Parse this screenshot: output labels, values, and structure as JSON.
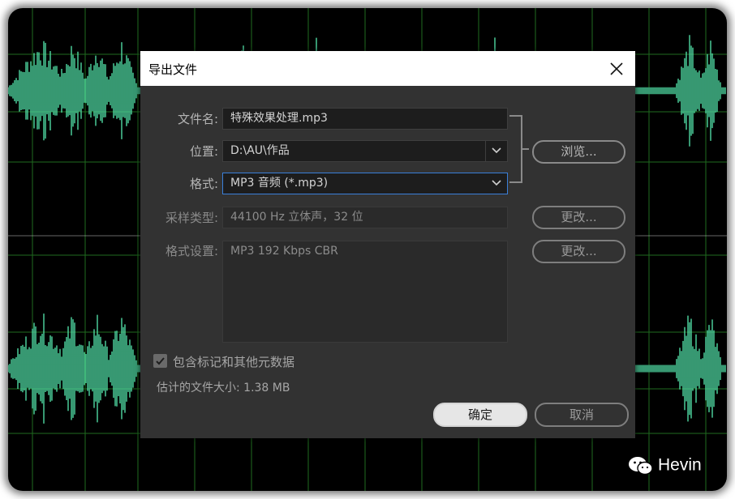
{
  "dialog": {
    "title": "导出文件",
    "filename_label": "文件名:",
    "filename_value": "特殊效果处理.mp3",
    "location_label": "位置:",
    "location_value": "D:\\AU\\作品",
    "format_label": "格式:",
    "format_value": "MP3 音频 (*.mp3)",
    "sample_type_label": "采样类型:",
    "sample_type_value": "44100 Hz 立体声，32 位",
    "format_settings_label": "格式设置:",
    "format_settings_value": "MP3 192 Kbps CBR",
    "browse_button": "浏览...",
    "change_button_1": "更改...",
    "change_button_2": "更改...",
    "include_markers_label": "包含标记和其他元数据",
    "include_markers_checked": true,
    "estimated_size": "估计的文件大小: 1.38 MB",
    "ok_button": "确定",
    "cancel_button": "取消"
  },
  "watermark": {
    "text": "Hevin",
    "icon": "wechat-icon"
  },
  "colors": {
    "waveform": "#4fd9a2",
    "grid": "#1f6b1f",
    "dialog_bg": "#323232",
    "focus_border": "#3a7fd9"
  }
}
